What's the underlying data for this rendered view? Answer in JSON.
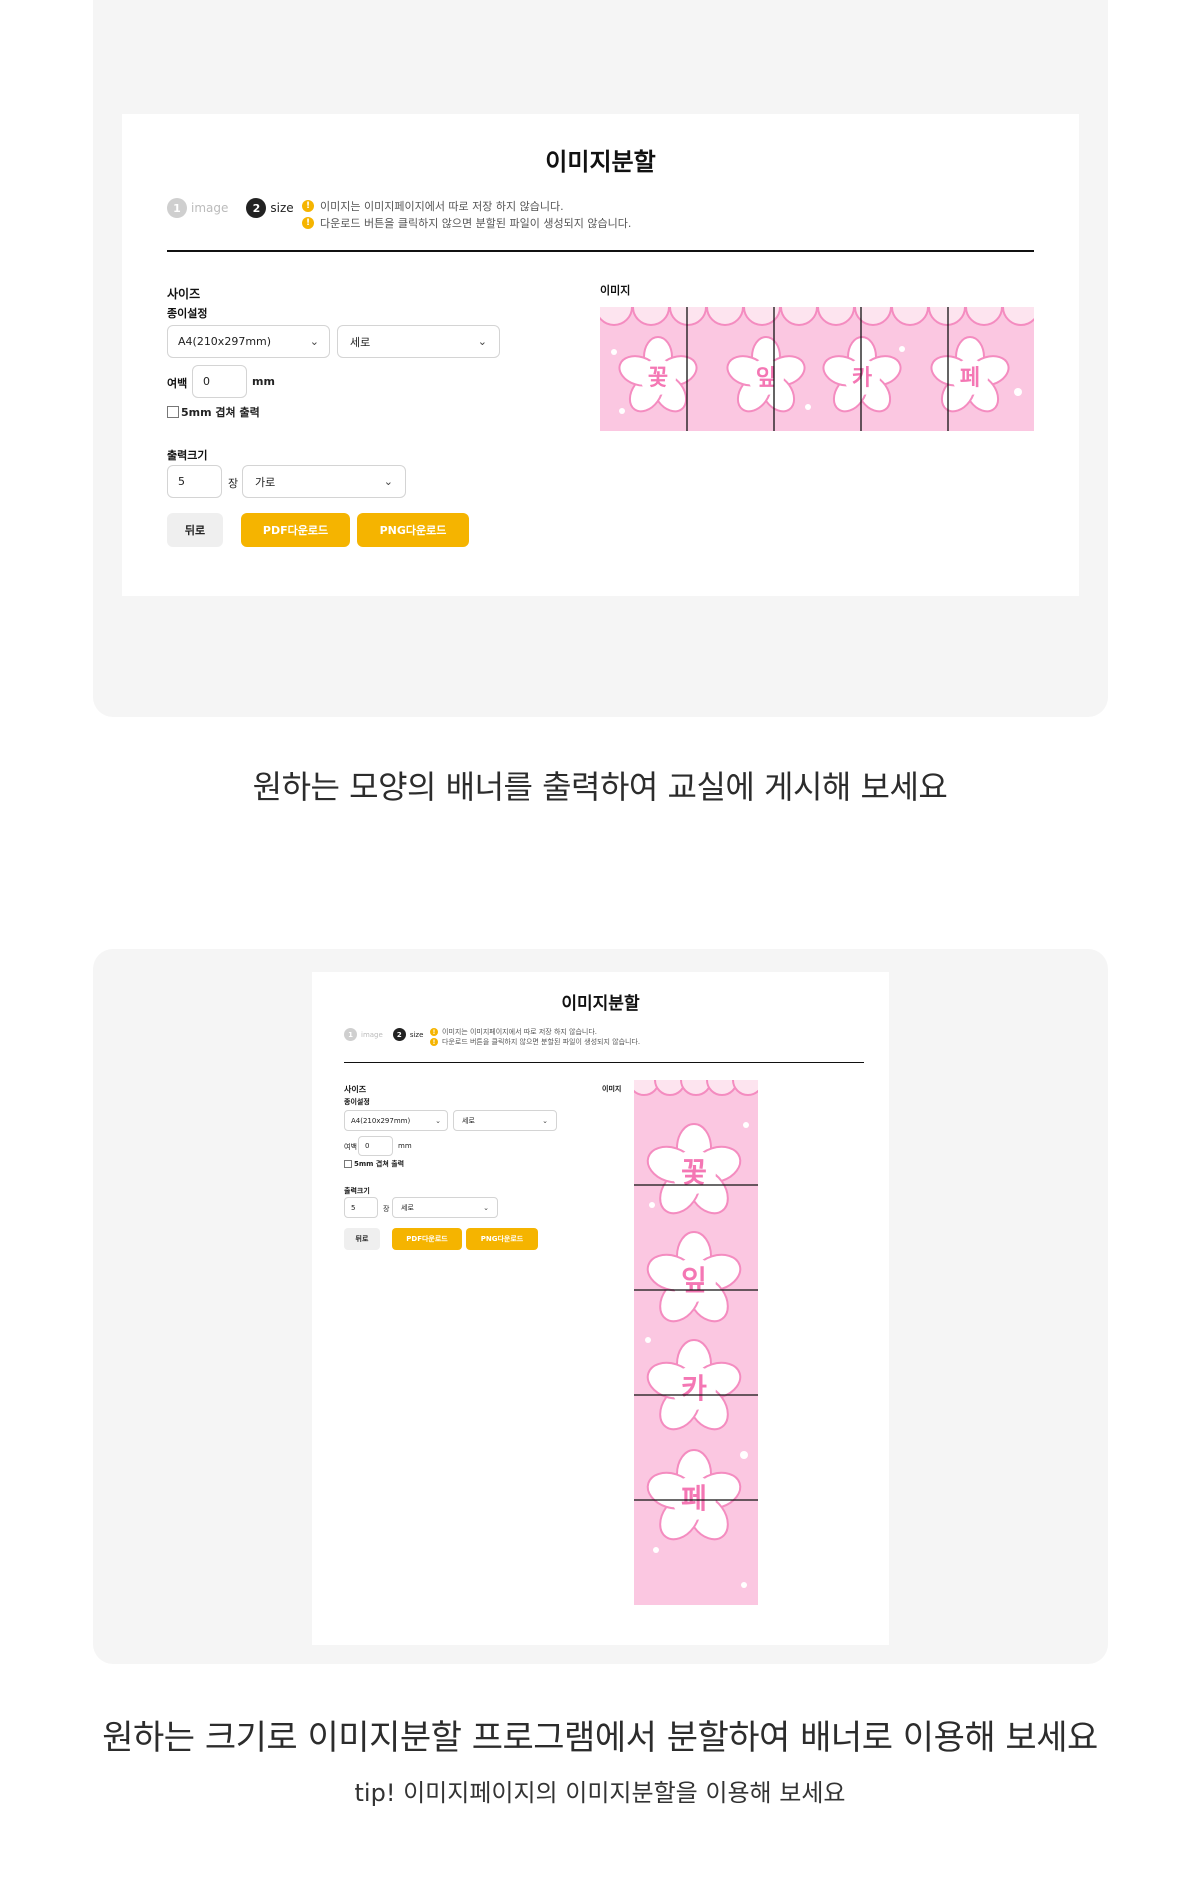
{
  "app": {
    "title": "이미지분할",
    "steps": [
      {
        "num": "1",
        "label": "image"
      },
      {
        "num": "2",
        "label": "size"
      }
    ],
    "notices": [
      "이미지는 이미지페이지에서 따로 저장 하지 않습니다.",
      "다운로드 버튼을 클릭하지 않으면 분할된 파일이 생성되지 않습니다."
    ],
    "warn_glyph": "!",
    "size_heading": "사이즈",
    "paper_label": "종이설정",
    "paper_value": "A4(210x297mm)",
    "orientation_value": "세로",
    "margin_label": "여백",
    "margin_value": "0",
    "margin_unit": "mm",
    "overlap_label": "5mm 겹쳐 출력",
    "output_label": "출력크기",
    "output_count": "5",
    "output_unit": "장",
    "image_label": "이미지",
    "back_button": "뒤로",
    "pdf_button": "PDF다운로드",
    "png_button": "PNG다운로드",
    "chevron": "⌄"
  },
  "shot1": {
    "direction_value": "가로"
  },
  "shot2": {
    "direction_value": "세로"
  },
  "banner": {
    "letters": [
      "꽃",
      "잎",
      "카",
      "페"
    ],
    "background": "#fbc7e1",
    "flower_border": "#f48cc0",
    "letter_color": "#f477b4"
  },
  "captions": {
    "first": "원하는 모양의 배너를 출력하여 교실에 게시해 보세요",
    "second": "원하는 크기로 이미지분할 프로그램에서 분할하여 배너로 이용해 보세요",
    "tip": "tip! 이미지페이지의 이미지분할을 이용해 보세요"
  },
  "colors": {
    "accent": "#f5b400",
    "card_bg": "#f5f5f5"
  }
}
